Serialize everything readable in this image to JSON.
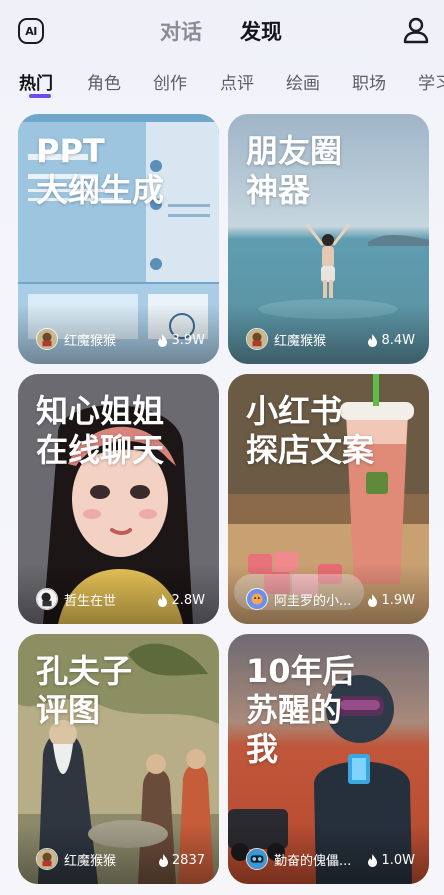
{
  "header": {
    "logo_text": "AI",
    "tabs": [
      {
        "label": "对话",
        "active": false
      },
      {
        "label": "发现",
        "active": true
      }
    ],
    "user_icon": "user-icon"
  },
  "categories": [
    {
      "label": "热门",
      "active": true
    },
    {
      "label": "角色",
      "active": false
    },
    {
      "label": "创作",
      "active": false
    },
    {
      "label": "点评",
      "active": false
    },
    {
      "label": "绘画",
      "active": false
    },
    {
      "label": "职场",
      "active": false
    },
    {
      "label": "学习",
      "active": false
    }
  ],
  "accent_color": "#6a4cf0",
  "cards": [
    {
      "title": "PPT\n大纲生成",
      "author": "红魔猴猴",
      "likes": "3.9W"
    },
    {
      "title": "朋友圈\n神器",
      "author": "红魔猴猴",
      "likes": "8.4W"
    },
    {
      "title": "知心姐姐\n在线聊天",
      "author": "哲生在世",
      "likes": "2.8W"
    },
    {
      "title": "小红书\n探店文案",
      "author": "阿圭罗的小...",
      "likes": "1.9W"
    },
    {
      "title": "孔夫子\n评图",
      "author": "红魔猴猴",
      "likes": "2837"
    },
    {
      "title": "10年后\n苏醒的\n我",
      "author": "勤奋的傀儡...",
      "likes": "1.0W"
    }
  ]
}
